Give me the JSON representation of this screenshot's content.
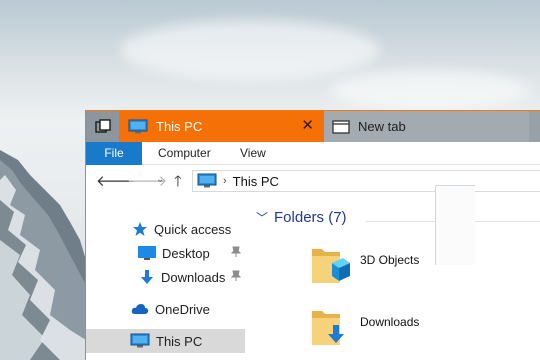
{
  "colors": {
    "accent": "#f57007",
    "file_tab": "#1979ca",
    "folder": "#f2c55c",
    "selected_row": "#d9d9d9"
  },
  "tabs": [
    {
      "label": "This PC",
      "icon": "this-pc-icon",
      "active": true
    },
    {
      "label": "New tab",
      "icon": "new-tab-icon",
      "active": false
    }
  ],
  "ribbon": {
    "file": "File",
    "computer": "Computer",
    "view": "View"
  },
  "address": {
    "path": "This PC"
  },
  "sidebar": {
    "quick_access": "Quick access",
    "desktop": "Desktop",
    "downloads": "Downloads",
    "onedrive": "OneDrive",
    "this_pc": "This PC"
  },
  "content": {
    "folders_header": "Folders (7)",
    "folders": [
      {
        "name": "3D Objects",
        "icon": "3d-objects-folder-icon"
      },
      {
        "name": "Downloads",
        "icon": "downloads-folder-icon"
      }
    ]
  }
}
